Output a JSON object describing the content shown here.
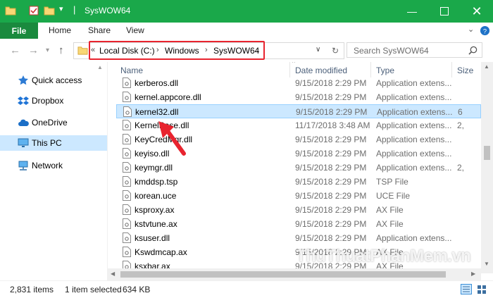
{
  "window": {
    "title": "SysWOW64",
    "accent": "#1aa84a"
  },
  "ribbon": {
    "file": "File",
    "tabs": [
      "Home",
      "Share",
      "View"
    ]
  },
  "nav": {
    "breadcrumb": [
      "Local Disk (C:)",
      "Windows",
      "SysWOW64"
    ],
    "search_placeholder": "Search SysWOW64"
  },
  "sidebar": {
    "items": [
      {
        "label": "Quick access",
        "icon": "star-icon"
      },
      {
        "label": "Dropbox",
        "icon": "dropbox-icon"
      },
      {
        "label": "OneDrive",
        "icon": "cloud-icon"
      },
      {
        "label": "This PC",
        "icon": "computer-icon",
        "selected": true
      },
      {
        "label": "Network",
        "icon": "network-icon"
      }
    ]
  },
  "columns": {
    "name": "Name",
    "date": "Date modified",
    "type": "Type",
    "size": "Size"
  },
  "files": [
    {
      "name": "kerberos.dll",
      "date": "9/15/2018 2:29 PM",
      "type": "Application extens...",
      "size": ""
    },
    {
      "name": "kernel.appcore.dll",
      "date": "9/15/2018 2:29 PM",
      "type": "Application extens...",
      "size": ""
    },
    {
      "name": "kernel32.dll",
      "date": "9/15/2018 2:29 PM",
      "type": "Application extens...",
      "size": "6",
      "selected": true
    },
    {
      "name": "KernelBase.dll",
      "date": "11/17/2018 3:48 AM",
      "type": "Application extens...",
      "size": "2,"
    },
    {
      "name": "KeyCredMgr.dll",
      "date": "9/15/2018 2:29 PM",
      "type": "Application extens...",
      "size": ""
    },
    {
      "name": "keyiso.dll",
      "date": "9/15/2018 2:29 PM",
      "type": "Application extens...",
      "size": ""
    },
    {
      "name": "keymgr.dll",
      "date": "9/15/2018 2:29 PM",
      "type": "Application extens...",
      "size": "2,"
    },
    {
      "name": "kmddsp.tsp",
      "date": "9/15/2018 2:29 PM",
      "type": "TSP File",
      "size": ""
    },
    {
      "name": "korean.uce",
      "date": "9/15/2018 2:29 PM",
      "type": "UCE File",
      "size": ""
    },
    {
      "name": "ksproxy.ax",
      "date": "9/15/2018 2:29 PM",
      "type": "AX File",
      "size": ""
    },
    {
      "name": "kstvtune.ax",
      "date": "9/15/2018 2:29 PM",
      "type": "AX File",
      "size": ""
    },
    {
      "name": "ksuser.dll",
      "date": "9/15/2018 2:29 PM",
      "type": "Application extens...",
      "size": ""
    },
    {
      "name": "Kswdmcap.ax",
      "date": "9/15/2018 2:29 PM",
      "type": "AX File",
      "size": ""
    },
    {
      "name": "ksxbar.ax",
      "date": "9/15/2018 2:29 PM",
      "type": "AX File",
      "size": ""
    }
  ],
  "status": {
    "items": "2,831 items",
    "selected": "1 item selected",
    "size": "634 KB"
  },
  "watermark": "ThuThuatPhanMem.vn"
}
